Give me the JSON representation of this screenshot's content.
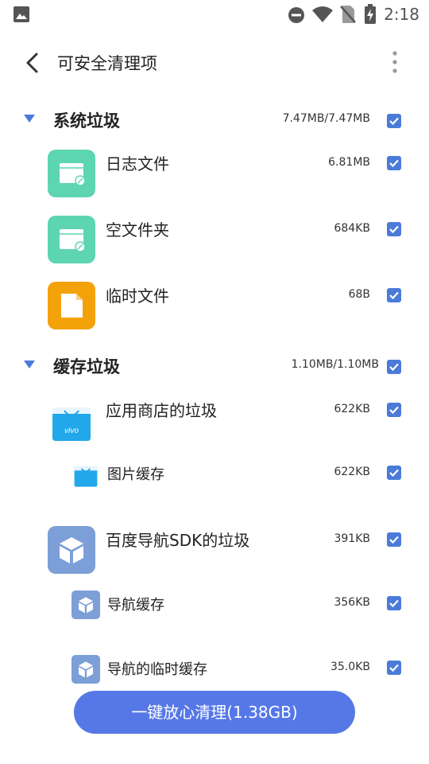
{
  "status_bar": {
    "time": "2:18"
  },
  "header": {
    "title": "可安全清理项"
  },
  "sections": [
    {
      "title": "系统垃圾",
      "size": "7.47MB/7.47MB",
      "checked": true,
      "items": [
        {
          "label": "日志文件",
          "size": "6.81MB",
          "icon": "log-file-icon",
          "checked": true
        },
        {
          "label": "空文件夹",
          "size": "684KB",
          "icon": "empty-folder-icon",
          "checked": true
        },
        {
          "label": "临时文件",
          "size": "68B",
          "icon": "temp-file-icon",
          "checked": true
        }
      ]
    },
    {
      "title": "缓存垃圾",
      "size": "1.10MB/1.10MB",
      "checked": true,
      "items": [
        {
          "label": "应用商店的垃圾",
          "size": "622KB",
          "icon": "app-store-icon",
          "checked": true,
          "children": [
            {
              "label": "图片缓存",
              "size": "622KB",
              "icon": "app-store-icon",
              "checked": true
            }
          ]
        },
        {
          "label": "百度导航SDK的垃圾",
          "size": "391KB",
          "icon": "sdk-box-icon",
          "checked": true,
          "children": [
            {
              "label": "导航缓存",
              "size": "356KB",
              "icon": "sdk-box-icon",
              "checked": true
            },
            {
              "label": "导航的临时缓存",
              "size": "35.0KB",
              "icon": "sdk-box-icon",
              "checked": true
            }
          ]
        }
      ]
    }
  ],
  "store_icon_text": "vivo",
  "colors": {
    "accent": "#4b7bd8",
    "button": "#5678e7",
    "green": "#5dd5b0",
    "orange": "#f4a20a",
    "sdk_blue": "#7c9fd8",
    "store_blue": "#21a7ea"
  },
  "clean_button": {
    "label": "一键放心清理(1.38GB)"
  }
}
